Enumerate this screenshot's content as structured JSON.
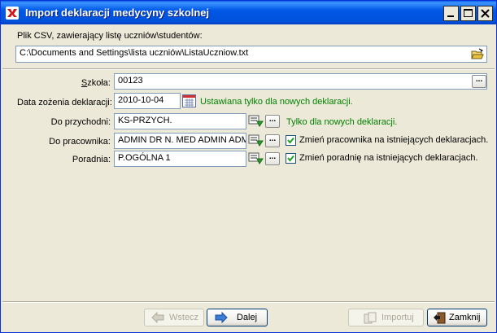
{
  "window": {
    "title": "Import deklaracji medycyny szkolnej"
  },
  "csv": {
    "label": "Plik CSV, zawierający listę uczniów\\studentów:",
    "path": "C:\\Documents and Settings\\lista uczniów\\ListaUczniow.txt"
  },
  "form": {
    "szkola_label": "Szkoła:",
    "szkola_value": "00123",
    "data_label": "Data zożenia deklaracji:",
    "data_value": "2010-10-04",
    "data_note": "Ustawiana tylko dla nowych deklaracji.",
    "przychodnia_label": "Do przychodni:",
    "przychodnia_value": "KS-PRZYCH.",
    "przychodnia_note": "Tylko dla nowych deklaracji.",
    "pracownik_label": "Do pracownika:",
    "pracownik_value": "ADMIN DR N. MED ADMIN ADM",
    "pracownik_check_label": "Zmień pracownika na istniejących deklaracjach.",
    "pracownik_checked": true,
    "poradnia_label": "Poradnia:",
    "poradnia_value": "P.OGÓLNA 1",
    "poradnia_check_label": "Zmień poradnię na istniejących deklaracjach.",
    "poradnia_checked": true,
    "ellipsis": "..."
  },
  "buttons": {
    "back": "Wstecz",
    "next": "Dalej",
    "import": "Importuj",
    "close": "Zamknij"
  },
  "icons": {
    "app": "app-icon",
    "folder": "open-folder-icon",
    "calendar": "calendar-icon",
    "dictionary": "dictionary-pick-icon"
  },
  "colors": {
    "titlebar": "#0058E6",
    "note_green": "#008000",
    "window_bg": "#ECE9D8"
  }
}
